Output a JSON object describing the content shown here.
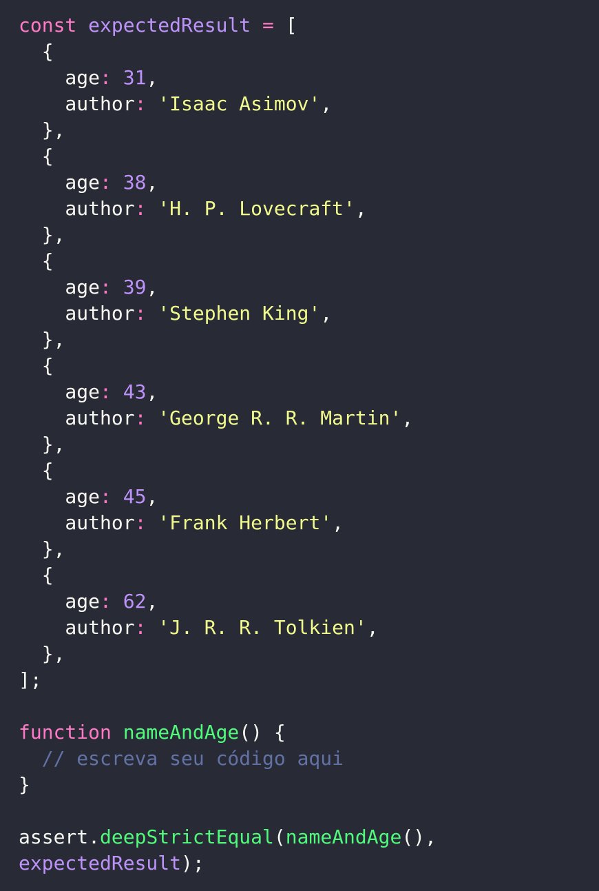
{
  "colors": {
    "background": "#282a36",
    "foreground": "#f8f8f2",
    "keyword": "#ff79c6",
    "variable": "#bd93f9",
    "number": "#bd93f9",
    "string": "#f1fa8c",
    "function": "#50fa7b",
    "comment": "#6272a4"
  },
  "code": {
    "lines": [
      [
        {
          "t": "const",
          "k": "keyword"
        },
        {
          "t": " ",
          "k": "plain"
        },
        {
          "t": "expectedResult",
          "k": "var"
        },
        {
          "t": " ",
          "k": "plain"
        },
        {
          "t": "=",
          "k": "op"
        },
        {
          "t": " [",
          "k": "plain"
        }
      ],
      [
        {
          "t": "  {",
          "k": "plain"
        }
      ],
      [
        {
          "t": "    age",
          "k": "plain"
        },
        {
          "t": ":",
          "k": "op"
        },
        {
          "t": " ",
          "k": "plain"
        },
        {
          "t": "31",
          "k": "num"
        },
        {
          "t": ",",
          "k": "plain"
        }
      ],
      [
        {
          "t": "    author",
          "k": "plain"
        },
        {
          "t": ":",
          "k": "op"
        },
        {
          "t": " ",
          "k": "plain"
        },
        {
          "t": "'Isaac Asimov'",
          "k": "str"
        },
        {
          "t": ",",
          "k": "plain"
        }
      ],
      [
        {
          "t": "  },",
          "k": "plain"
        }
      ],
      [
        {
          "t": "  {",
          "k": "plain"
        }
      ],
      [
        {
          "t": "    age",
          "k": "plain"
        },
        {
          "t": ":",
          "k": "op"
        },
        {
          "t": " ",
          "k": "plain"
        },
        {
          "t": "38",
          "k": "num"
        },
        {
          "t": ",",
          "k": "plain"
        }
      ],
      [
        {
          "t": "    author",
          "k": "plain"
        },
        {
          "t": ":",
          "k": "op"
        },
        {
          "t": " ",
          "k": "plain"
        },
        {
          "t": "'H. P. Lovecraft'",
          "k": "str"
        },
        {
          "t": ",",
          "k": "plain"
        }
      ],
      [
        {
          "t": "  },",
          "k": "plain"
        }
      ],
      [
        {
          "t": "  {",
          "k": "plain"
        }
      ],
      [
        {
          "t": "    age",
          "k": "plain"
        },
        {
          "t": ":",
          "k": "op"
        },
        {
          "t": " ",
          "k": "plain"
        },
        {
          "t": "39",
          "k": "num"
        },
        {
          "t": ",",
          "k": "plain"
        }
      ],
      [
        {
          "t": "    author",
          "k": "plain"
        },
        {
          "t": ":",
          "k": "op"
        },
        {
          "t": " ",
          "k": "plain"
        },
        {
          "t": "'Stephen King'",
          "k": "str"
        },
        {
          "t": ",",
          "k": "plain"
        }
      ],
      [
        {
          "t": "  },",
          "k": "plain"
        }
      ],
      [
        {
          "t": "  {",
          "k": "plain"
        }
      ],
      [
        {
          "t": "    age",
          "k": "plain"
        },
        {
          "t": ":",
          "k": "op"
        },
        {
          "t": " ",
          "k": "plain"
        },
        {
          "t": "43",
          "k": "num"
        },
        {
          "t": ",",
          "k": "plain"
        }
      ],
      [
        {
          "t": "    author",
          "k": "plain"
        },
        {
          "t": ":",
          "k": "op"
        },
        {
          "t": " ",
          "k": "plain"
        },
        {
          "t": "'George R. R. Martin'",
          "k": "str"
        },
        {
          "t": ",",
          "k": "plain"
        }
      ],
      [
        {
          "t": "  },",
          "k": "plain"
        }
      ],
      [
        {
          "t": "  {",
          "k": "plain"
        }
      ],
      [
        {
          "t": "    age",
          "k": "plain"
        },
        {
          "t": ":",
          "k": "op"
        },
        {
          "t": " ",
          "k": "plain"
        },
        {
          "t": "45",
          "k": "num"
        },
        {
          "t": ",",
          "k": "plain"
        }
      ],
      [
        {
          "t": "    author",
          "k": "plain"
        },
        {
          "t": ":",
          "k": "op"
        },
        {
          "t": " ",
          "k": "plain"
        },
        {
          "t": "'Frank Herbert'",
          "k": "str"
        },
        {
          "t": ",",
          "k": "plain"
        }
      ],
      [
        {
          "t": "  },",
          "k": "plain"
        }
      ],
      [
        {
          "t": "  {",
          "k": "plain"
        }
      ],
      [
        {
          "t": "    age",
          "k": "plain"
        },
        {
          "t": ":",
          "k": "op"
        },
        {
          "t": " ",
          "k": "plain"
        },
        {
          "t": "62",
          "k": "num"
        },
        {
          "t": ",",
          "k": "plain"
        }
      ],
      [
        {
          "t": "    author",
          "k": "plain"
        },
        {
          "t": ":",
          "k": "op"
        },
        {
          "t": " ",
          "k": "plain"
        },
        {
          "t": "'J. R. R. Tolkien'",
          "k": "str"
        },
        {
          "t": ",",
          "k": "plain"
        }
      ],
      [
        {
          "t": "  },",
          "k": "plain"
        }
      ],
      [
        {
          "t": "];",
          "k": "plain"
        }
      ],
      [],
      [
        {
          "t": "function",
          "k": "keyword"
        },
        {
          "t": " ",
          "k": "plain"
        },
        {
          "t": "nameAndAge",
          "k": "func"
        },
        {
          "t": "() {",
          "k": "plain"
        }
      ],
      [
        {
          "t": "  // escreva seu código aqui",
          "k": "comment"
        }
      ],
      [
        {
          "t": "}",
          "k": "plain"
        }
      ],
      [],
      [
        {
          "t": "assert.",
          "k": "plain"
        },
        {
          "t": "deepStrictEqual",
          "k": "func"
        },
        {
          "t": "(",
          "k": "plain"
        },
        {
          "t": "nameAndAge",
          "k": "func"
        },
        {
          "t": "(),",
          "k": "plain"
        }
      ],
      [
        {
          "t": "expectedResult",
          "k": "var"
        },
        {
          "t": ");",
          "k": "plain"
        }
      ]
    ]
  }
}
